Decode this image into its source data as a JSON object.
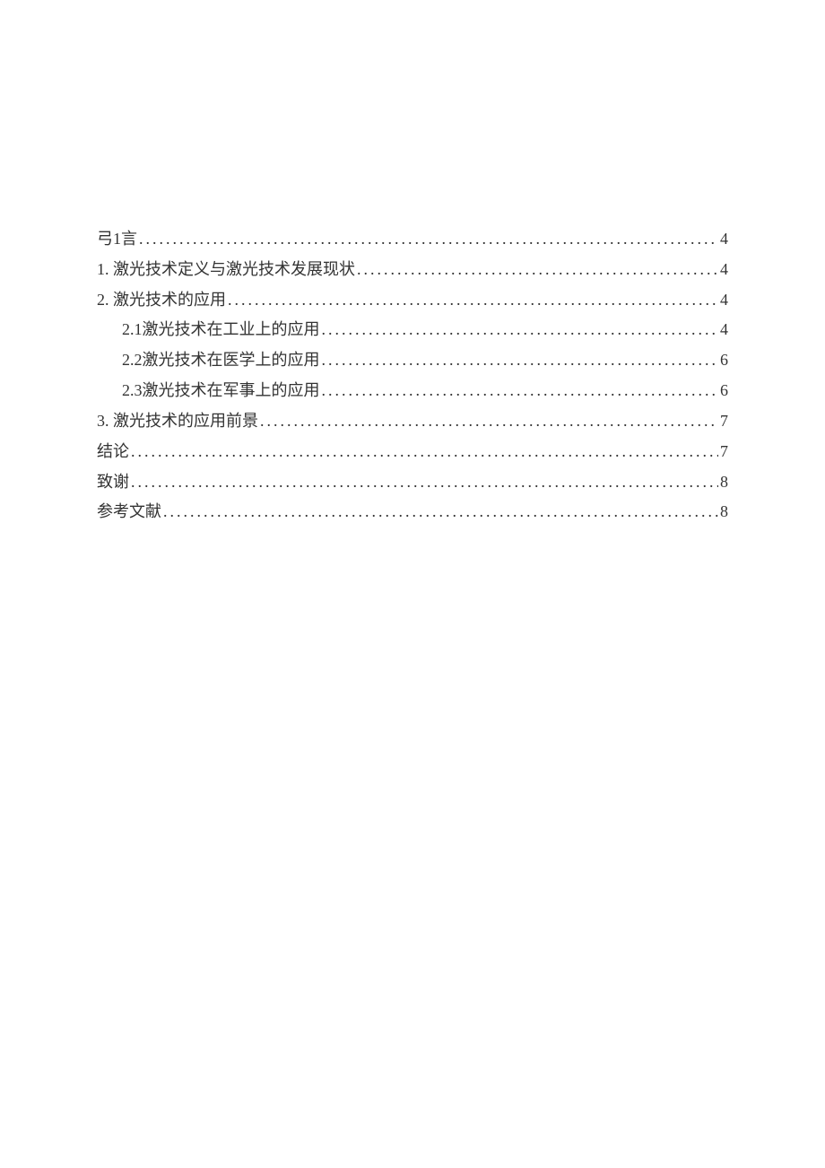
{
  "toc": [
    {
      "label": "弓1言",
      "page": "4",
      "level": 1
    },
    {
      "label": "1.  激光技术定义与激光技术发展现状",
      "page": "4",
      "level": 1
    },
    {
      "label": "2.  激光技术的应用",
      "page": "4",
      "level": 1
    },
    {
      "label": "2.1激光技术在工业上的应用 ",
      "page": "4",
      "level": 2
    },
    {
      "label": "2.2激光技术在医学上的应用 ",
      "page": "6",
      "level": 2
    },
    {
      "label": "2.3激光技术在军事上的应用 ",
      "page": "6",
      "level": 2
    },
    {
      "label": "3.  激光技术的应用前景",
      "page": "7",
      "level": 1
    },
    {
      "label": "结论 ",
      "page": "7",
      "level": 1
    },
    {
      "label": "致谢",
      "page": "8",
      "level": 1
    },
    {
      "label": "参考文献",
      "page": "8",
      "level": 1
    }
  ]
}
